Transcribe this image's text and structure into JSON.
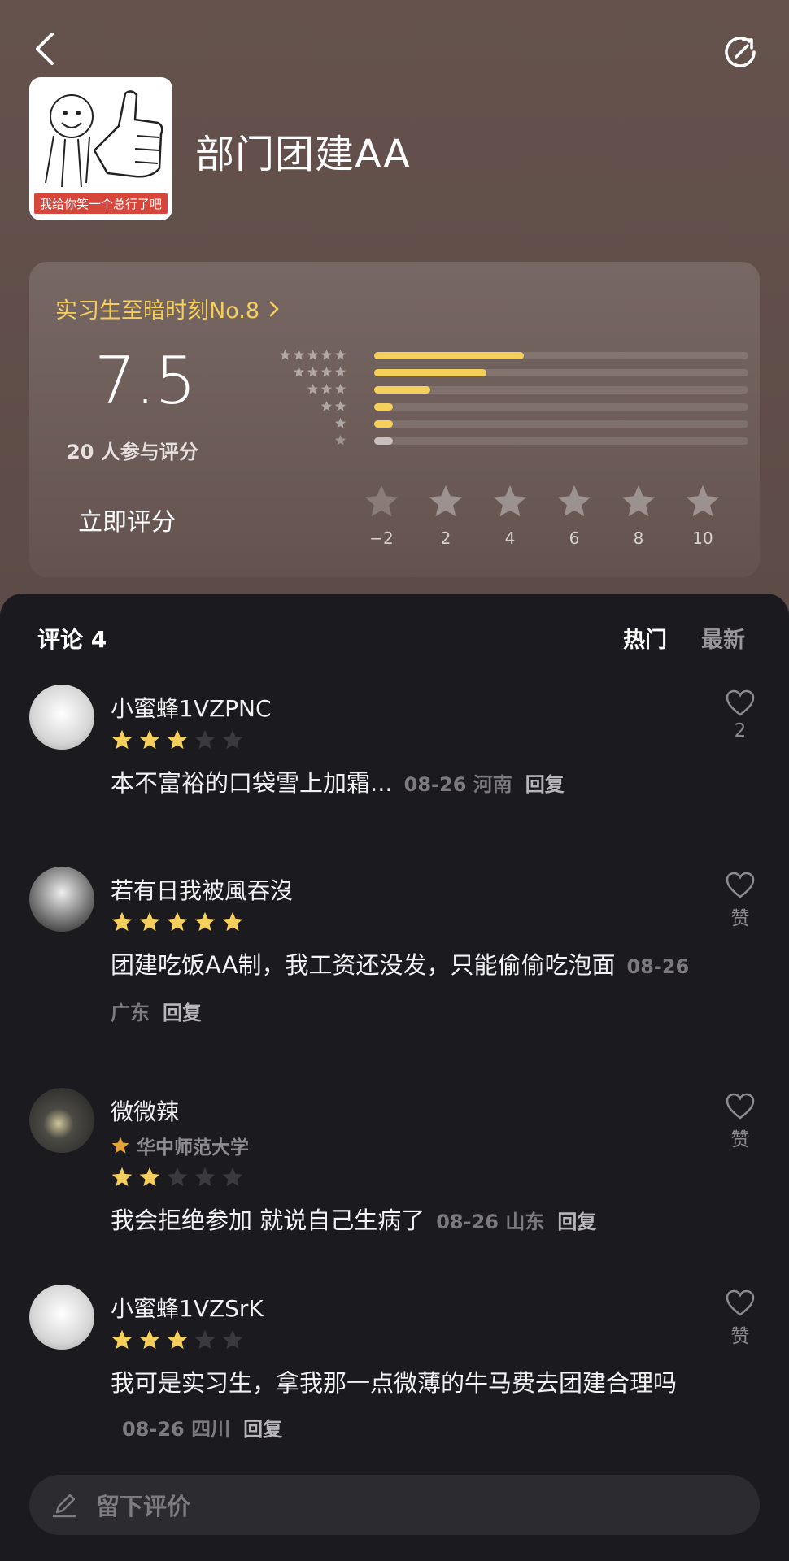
{
  "header": {
    "back_icon": "back-chevron-icon",
    "share_icon": "share-icon",
    "cover_caption": "我给你笑一个总行了吧",
    "title": "部门团建AA"
  },
  "rating": {
    "rank_label": "实习生至暗时刻No.8",
    "score": "7.5",
    "participants": "20 人参与评分",
    "distribution": [
      {
        "stars": 5,
        "fraction": 0.4
      },
      {
        "stars": 4,
        "fraction": 0.3
      },
      {
        "stars": 3,
        "fraction": 0.15
      },
      {
        "stars": 2,
        "fraction": 0.05
      },
      {
        "stars": 1,
        "fraction": 0.05
      },
      {
        "stars": 0,
        "fraction": 0.05
      }
    ],
    "rate_now_label": "立即评分",
    "rate_options": [
      "−2",
      "2",
      "4",
      "6",
      "8",
      "10"
    ]
  },
  "comments": {
    "title": "评论 4",
    "tab_hot": "热门",
    "tab_new": "最新",
    "items": [
      {
        "name": "小蜜蜂1VZPNC",
        "stars": 3,
        "text": "本不富裕的口袋雪上加霜...",
        "date": "08-26",
        "region": "河南",
        "reply": "回复",
        "like_label": "2"
      },
      {
        "name": "若有日我被風吞沒",
        "stars": 5,
        "text": "团建吃饭AA制，我工资还没发，只能偷偷吃泡面",
        "date": "08-26",
        "region": "广东",
        "reply": "回复",
        "like_label": "赞"
      },
      {
        "name": "微微辣",
        "verified": "华中师范大学",
        "stars": 2,
        "text": "我会拒绝参加 就说自己生病了",
        "date": "08-26",
        "region": "山东",
        "reply": "回复",
        "like_label": "赞"
      },
      {
        "name": "小蜜蜂1VZSrK",
        "stars": 3,
        "text": "我可是实习生，拿我那一点微薄的牛马费去团建合理吗",
        "date": "08-26",
        "region": "四川",
        "reply": "回复",
        "like_label": "赞"
      }
    ]
  },
  "input": {
    "placeholder": "留下评价"
  },
  "colors": {
    "accent": "#f4cf5b",
    "sheet_bg": "#1b1a1f",
    "header_bg": "#5f4e4a"
  }
}
